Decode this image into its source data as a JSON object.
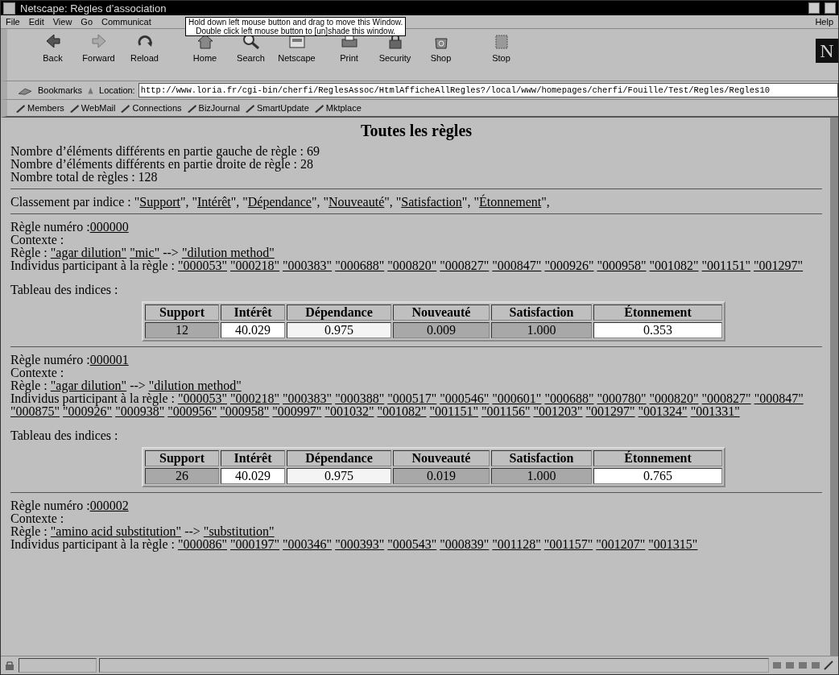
{
  "window": {
    "title": "Netscape: Règles d’association",
    "tooltip": [
      "Hold down left mouse button and drag to move this Window.",
      "Double click left mouse button to [un]shade this window."
    ]
  },
  "menu": {
    "items": [
      "File",
      "Edit",
      "View",
      "Go",
      "Communicat"
    ],
    "help": "Help"
  },
  "toolbar": [
    {
      "label": "Back",
      "kind": "back"
    },
    {
      "label": "Forward",
      "kind": "forward"
    },
    {
      "label": "Reload",
      "kind": "reload"
    },
    {
      "label": "Home",
      "kind": "home"
    },
    {
      "label": "Search",
      "kind": "search"
    },
    {
      "label": "Netscape",
      "kind": "netscape"
    },
    {
      "label": "Print",
      "kind": "print"
    },
    {
      "label": "Security",
      "kind": "security"
    },
    {
      "label": "Shop",
      "kind": "shop"
    },
    {
      "label": "Stop",
      "kind": "stop"
    }
  ],
  "logo": "N",
  "location": {
    "bookmarks": "Bookmarks",
    "label": "Location:",
    "url": "http://www.loria.fr/cgi-bin/cherfi/ReglesAssoc/HtmlAfficheAllRegles?/local/www/homepages/cherfi/Fouille/Test/Regles/Regles10"
  },
  "personal_toolbar": [
    "Members",
    "WebMail",
    "Connections",
    "BizJournal",
    "SmartUpdate",
    "Mktplace"
  ],
  "page": {
    "title": "Toutes les règles",
    "stats": [
      "Nombre d’éléments différents en partie gauche de règle : 69",
      "Nombre d’éléments différents en partie droite de règle : 28",
      "Nombre total de règles : 128"
    ],
    "ranking": {
      "label": "Classement par indice : ",
      "items": [
        {
          "before": "\"",
          "link": "Support",
          "after": "\", "
        },
        {
          "before": "\"",
          "link": "Intérêt",
          "after": "\", "
        },
        {
          "before": "\"",
          "link": "Dépendance",
          "after": "\", "
        },
        {
          "before": "\"",
          "link": "Nouveauté",
          "after": "\", "
        },
        {
          "before": "\"",
          "link": "Satisfaction",
          "after": "\", "
        },
        {
          "before": "\"",
          "link": "Étonnement",
          "after": "\","
        }
      ]
    },
    "rules": [
      {
        "number_label": "Règle numéro :",
        "number": "000000",
        "context": "Contexte :",
        "rule_label": "Règle : ",
        "antecedents": [
          "\"agar dilution\"",
          "\"mic\""
        ],
        "arrow": "-->",
        "consequents": [
          "\"dilution method\""
        ],
        "individuals_label": "Individus participant à la règle : ",
        "individuals": [
          "\"000053\"",
          "\"000218\"",
          "\"000383\"",
          "\"000688\"",
          "\"000820\"",
          "\"000827\"",
          "\"000847\"",
          "\"000926\"",
          "\"000958\"",
          "\"001082\"",
          "\"001151\"",
          "\"001297\""
        ],
        "table": {
          "label": "Tableau des indices :",
          "headers": [
            "Support",
            "Intérêt",
            "Dépendance",
            "Nouveauté",
            "Satisfaction",
            "Étonnement"
          ],
          "cells": [
            {
              "value": "12",
              "color": "#a8a8a8"
            },
            {
              "value": "40.029",
              "color": "#ffffff"
            },
            {
              "value": "0.975",
              "color": "#f4f4f4"
            },
            {
              "value": "0.009",
              "color": "#a8a8a8"
            },
            {
              "value": "1.000",
              "color": "#a8a8a8"
            },
            {
              "value": "0.353",
              "color": "#ffffff"
            }
          ]
        }
      },
      {
        "number_label": "Règle numéro :",
        "number": "000001",
        "context": "Contexte :",
        "rule_label": "Règle : ",
        "antecedents": [
          "\"agar dilution\""
        ],
        "arrow": "-->",
        "consequents": [
          "\"dilution method\""
        ],
        "individuals_label": "Individus participant à la règle : ",
        "individuals": [
          "\"000053\"",
          "\"000218\"",
          "\"000383\"",
          "\"000388\"",
          "\"000517\"",
          "\"000546\"",
          "\"000601\"",
          "\"000688\"",
          "\"000780\"",
          "\"000820\"",
          "\"000827\"",
          "\"000847\"",
          "\"000875\"",
          "\"000926\"",
          "\"000938\"",
          "\"000956\"",
          "\"000958\"",
          "\"000997\"",
          "\"001032\"",
          "\"001082\"",
          "\"001151\"",
          "\"001156\"",
          "\"001203\"",
          "\"001297\"",
          "\"001324\"",
          "\"001331\""
        ],
        "table": {
          "label": "Tableau des indices :",
          "headers": [
            "Support",
            "Intérêt",
            "Dépendance",
            "Nouveauté",
            "Satisfaction",
            "Étonnement"
          ],
          "cells": [
            {
              "value": "26",
              "color": "#a8a8a8"
            },
            {
              "value": "40.029",
              "color": "#ffffff"
            },
            {
              "value": "0.975",
              "color": "#f4f4f4"
            },
            {
              "value": "0.019",
              "color": "#a8a8a8"
            },
            {
              "value": "1.000",
              "color": "#a8a8a8"
            },
            {
              "value": "0.765",
              "color": "#ffffff"
            }
          ]
        }
      },
      {
        "number_label": "Règle numéro :",
        "number": "000002",
        "context": "Contexte :",
        "rule_label": "Règle : ",
        "antecedents": [
          "\"amino acid substitution\""
        ],
        "arrow": "-->",
        "consequents": [
          "\"substitution\""
        ],
        "individuals_label": "Individus participant à la règle : ",
        "individuals": [
          "\"000086\"",
          "\"000197\"",
          "\"000346\"",
          "\"000393\"",
          "\"000543\"",
          "\"000839\"",
          "\"001128\"",
          "\"001157\"",
          "\"001207\"",
          "\"001315\""
        ]
      }
    ]
  }
}
